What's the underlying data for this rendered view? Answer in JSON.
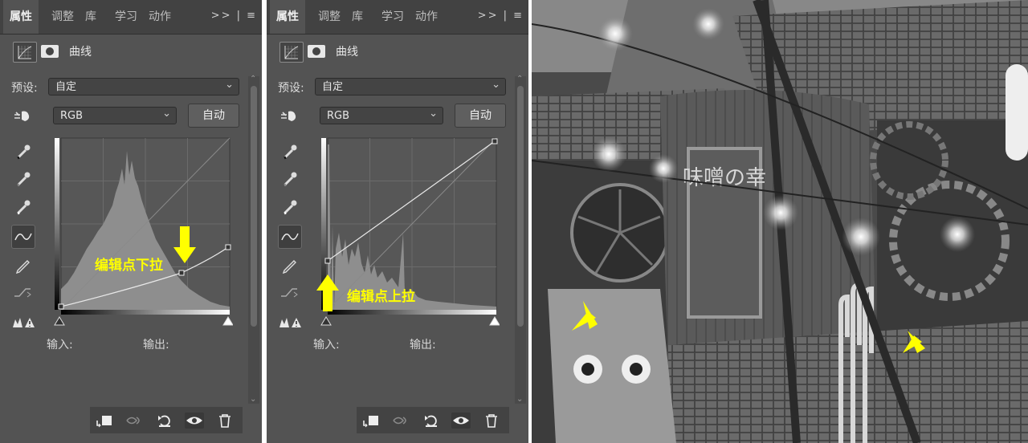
{
  "panels": [
    {
      "tabs": [
        "属性",
        "调整",
        "库",
        "学习",
        "动作"
      ],
      "tab_icons": ">> | ≡",
      "header_label": "曲线",
      "preset_label": "预设:",
      "preset_value": "自定",
      "channel_value": "RGB",
      "auto_label": "自动",
      "input_label": "输入:",
      "output_label": "输出:",
      "annotation": "编辑点下拉"
    },
    {
      "tabs": [
        "属性",
        "调整",
        "库",
        "学习",
        "动作"
      ],
      "tab_icons": ">> | ≡",
      "header_label": "曲线",
      "preset_label": "预设:",
      "preset_value": "自定",
      "channel_value": "RGB",
      "auto_label": "自动",
      "input_label": "输入:",
      "output_label": "输出:",
      "annotation": "编辑点上拉"
    }
  ],
  "photo": {
    "sign_text": "味噌の幸"
  },
  "colors": {
    "panel_bg": "#535353",
    "tab_bg": "#424242",
    "annotation": "#ffff00"
  },
  "icons": [
    "curves-adjust-icon",
    "mask-icon",
    "target-hand-icon",
    "eyedropper-black-icon",
    "eyedropper-gray-icon",
    "eyedropper-white-icon",
    "curve-point-icon",
    "pencil-icon",
    "smooth-icon",
    "clipping-warning-icon",
    "clip-layer-icon",
    "view-previous-icon",
    "reset-icon",
    "visibility-eye-icon",
    "trash-icon"
  ]
}
